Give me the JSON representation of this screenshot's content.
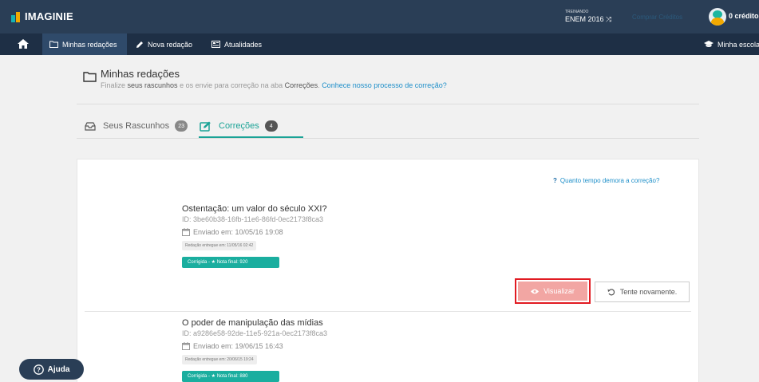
{
  "brand": {
    "name": "IMAGINIE"
  },
  "topbar": {
    "training_label": "TREINANDO",
    "training_value": "ENEM 2016 ⤨",
    "buy_credits": "Comprar Créditos",
    "credits": "0 créditos"
  },
  "nav": {
    "items": [
      {
        "label": "Minhas redações",
        "icon": "folder-icon"
      },
      {
        "label": "Nova redação",
        "icon": "pencil-icon"
      },
      {
        "label": "Atualidades",
        "icon": "newspaper-icon"
      }
    ],
    "right": {
      "label": "Minha escola",
      "icon": "graduation-cap-icon"
    }
  },
  "page": {
    "title": "Minhas redações",
    "subtitle_pre": "Finalize ",
    "subtitle_drafts": "seus rascunhos",
    "subtitle_mid": " e os envie para correção na aba ",
    "subtitle_tab": "Correções",
    "subtitle_dot": ". ",
    "subtitle_link": "Conhece nosso processo de correção?"
  },
  "tabs": [
    {
      "label": "Seus Rascunhos",
      "count": "23"
    },
    {
      "label": "Correções",
      "count": "4"
    }
  ],
  "help_link": "Quanto tempo demora a correção?",
  "essays": [
    {
      "title": "Ostentação: um valor do século XXI?",
      "id": "ID: 3be60b38-16fb-11e6-86fd-0ec2173f8ca3",
      "sent": "Enviado em: 10/05/16 19:08",
      "delivered": "Redação entregue em: 11/05/16 02:42",
      "grade": "Corrigida - ★ Nota final: 920"
    },
    {
      "title": "O poder de manipulação das mídias",
      "id": "ID: a9286e58-92de-11e5-921a-0ec2173f8ca3",
      "sent": "Enviado em: 19/06/15 16:43",
      "delivered": "Redação entregue em: 20/06/15 19:24",
      "grade": "Corrigida - ★ Nota final: 880"
    }
  ],
  "actions": {
    "view": "Visualizar",
    "retry": "Tente novamente."
  },
  "help_button": "Ajuda",
  "colors": {
    "topbar": "#2a3e56",
    "navbar": "#1e2f45",
    "accent": "#1aa396",
    "link": "#1e8fc9",
    "highlight": "#e11b22"
  }
}
